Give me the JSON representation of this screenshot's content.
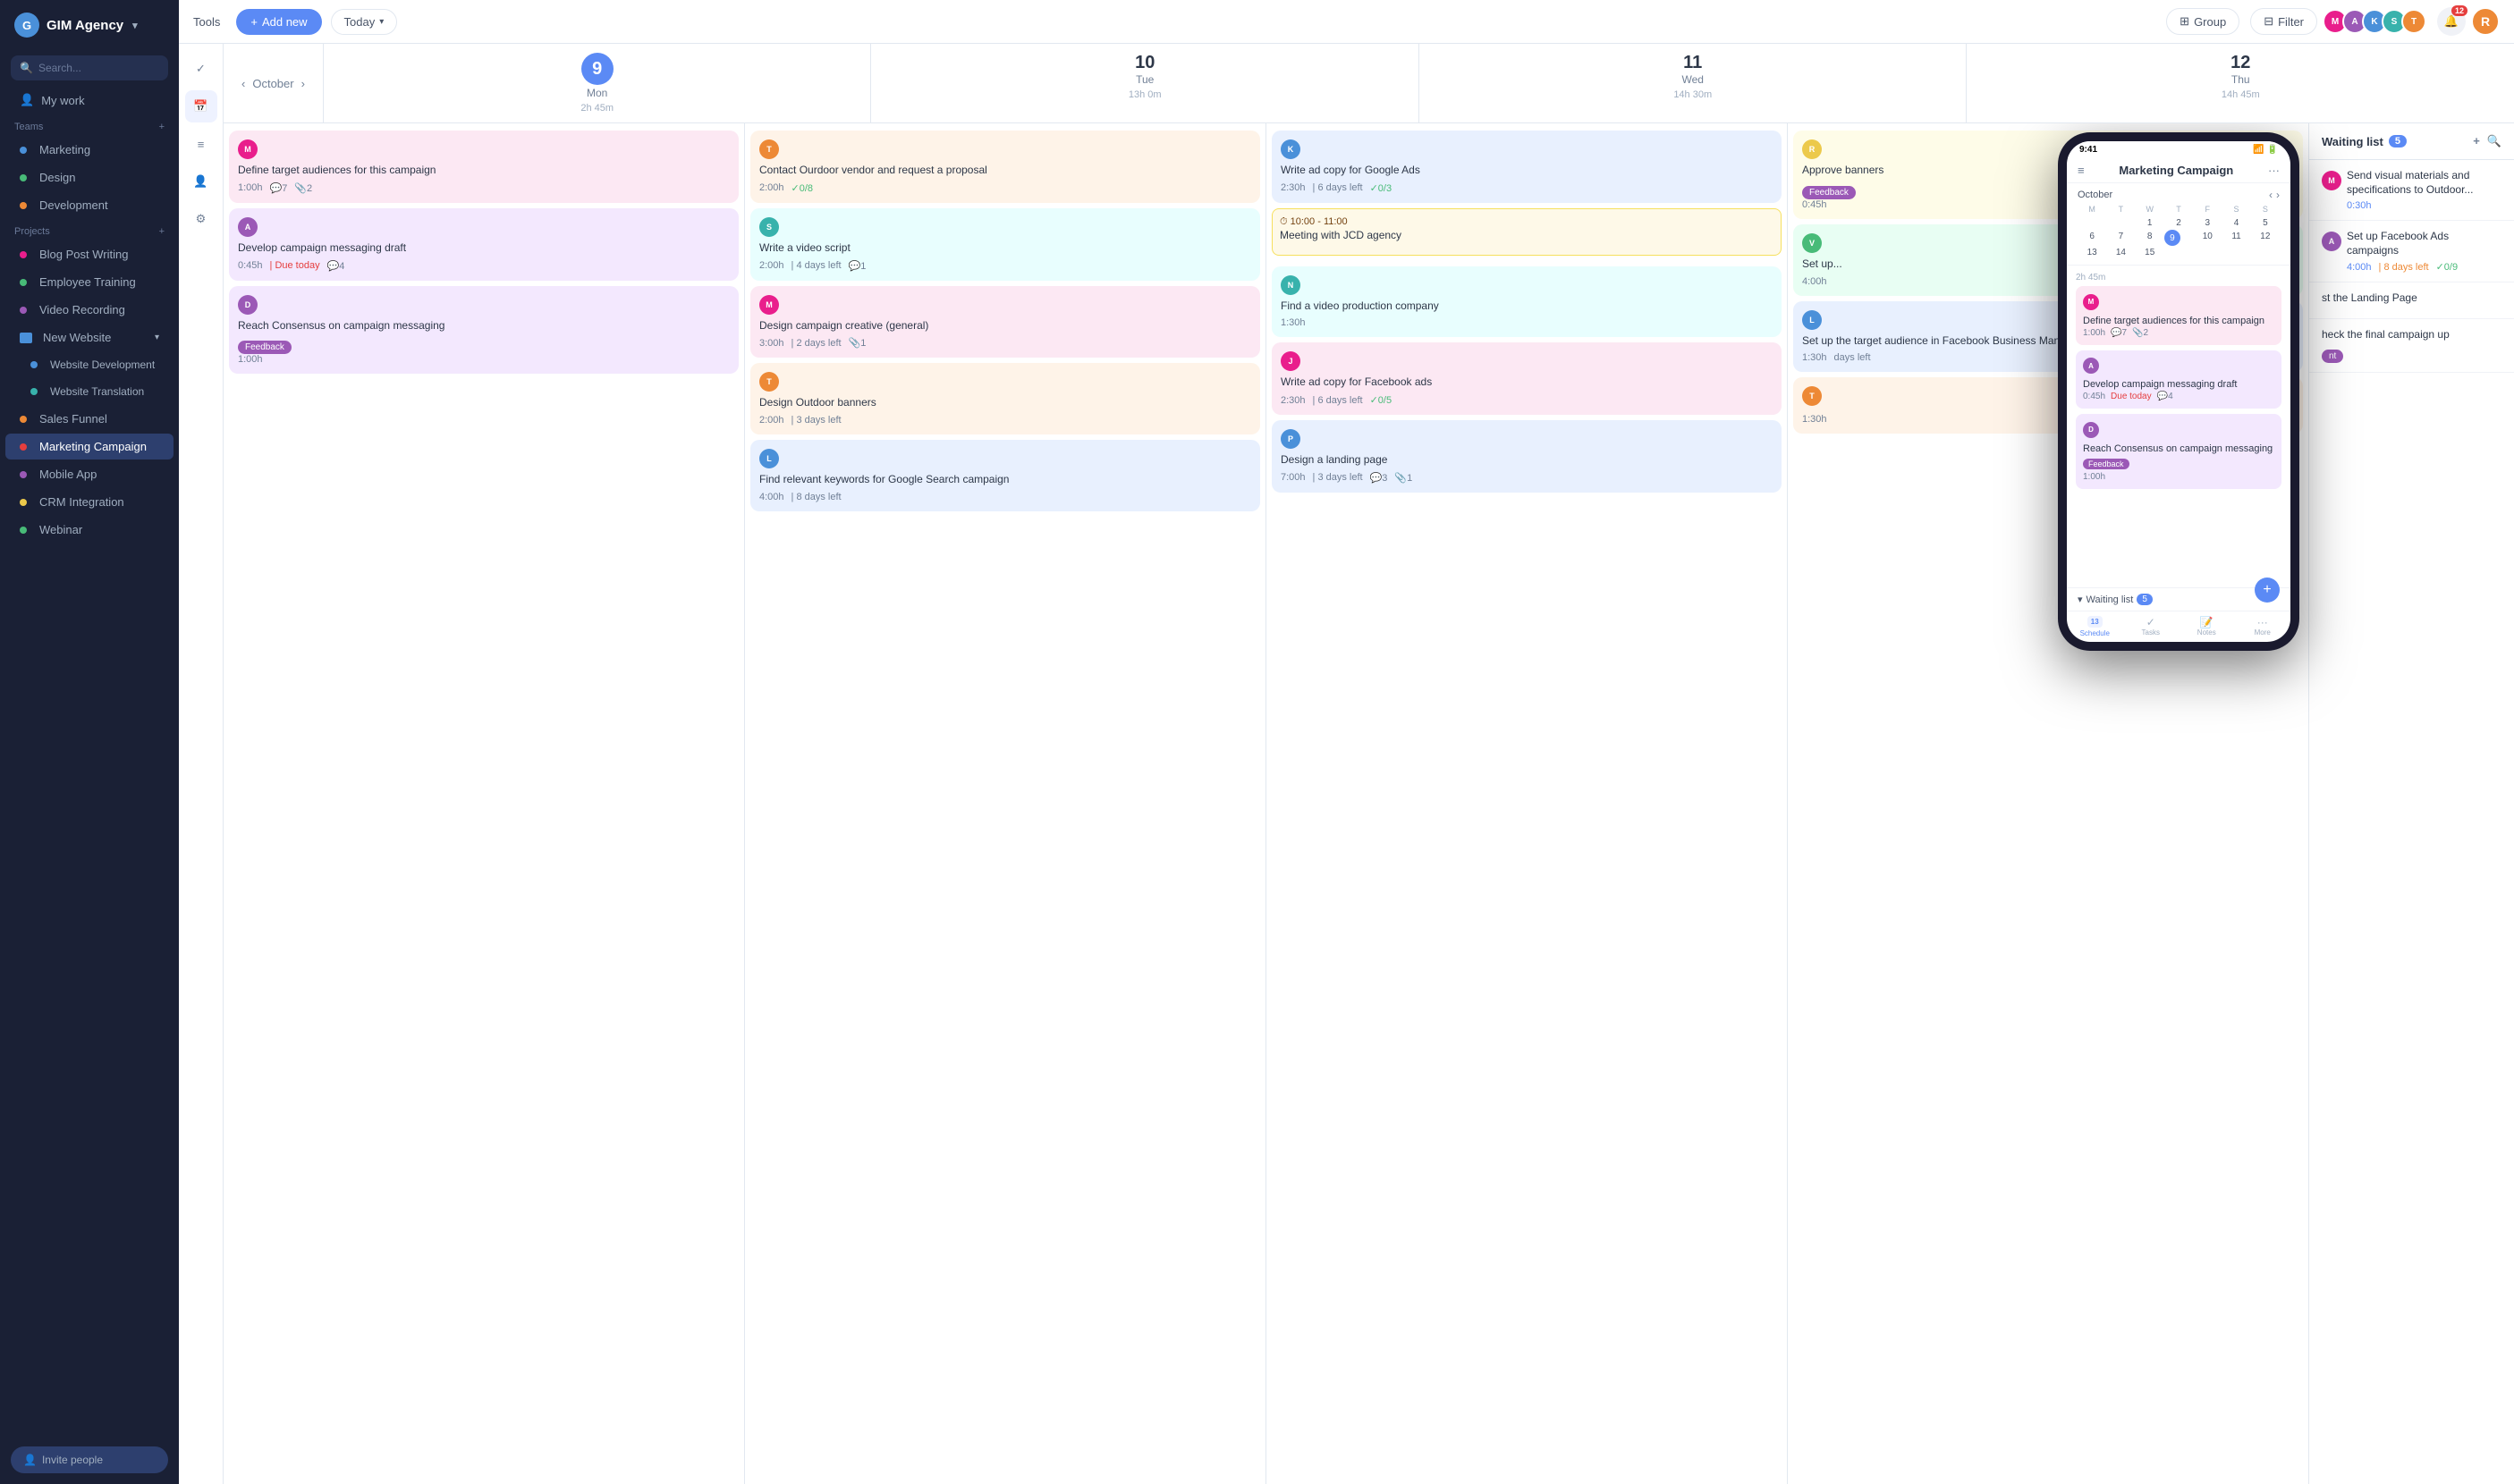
{
  "app": {
    "name": "GIM Agency",
    "logo_letter": "G"
  },
  "sidebar": {
    "search_placeholder": "Search...",
    "my_work": "My work",
    "teams_label": "Teams",
    "teams": [
      {
        "label": "Marketing",
        "color": "#4a90d9"
      },
      {
        "label": "Design",
        "color": "#48bb78"
      },
      {
        "label": "Development",
        "color": "#ed8936"
      }
    ],
    "projects_label": "Projects",
    "projects": [
      {
        "label": "Blog Post Writing",
        "color": "#e91e8c"
      },
      {
        "label": "Employee Training",
        "color": "#48bb78"
      },
      {
        "label": "Video Recording",
        "color": "#9b59b6"
      },
      {
        "label": "New Website",
        "color": "#4a90d9",
        "expanded": true
      },
      {
        "label": "Website Development",
        "color": "#4a90d9",
        "indented": true
      },
      {
        "label": "Website Translation",
        "color": "#38b2ac",
        "indented": true
      },
      {
        "label": "Sales Funnel",
        "color": "#ed8936"
      },
      {
        "label": "Marketing Campaign",
        "color": "#e53e3e",
        "active": true
      },
      {
        "label": "Mobile App",
        "color": "#9b59b6"
      },
      {
        "label": "CRM Integration",
        "color": "#ecc94b"
      },
      {
        "label": "Webinar",
        "color": "#48bb78"
      }
    ],
    "invite_btn": "Invite people"
  },
  "toolbar": {
    "tools_label": "Tools",
    "add_btn": "+ Add new",
    "today_btn": "Today",
    "group_btn": "Group",
    "filter_btn": "Filter"
  },
  "calendar": {
    "month": "October",
    "nav_prev": "‹",
    "nav_next": "›",
    "days": [
      {
        "num": "9",
        "name": "Mon",
        "time": "2h 45m",
        "today": true
      },
      {
        "num": "10",
        "name": "Tue",
        "time": "13h 0m"
      },
      {
        "num": "11",
        "name": "Wed",
        "time": "14h 30m"
      },
      {
        "num": "12",
        "name": "Thu",
        "time": "14h 45m"
      }
    ]
  },
  "tasks": {
    "mon": [
      {
        "title": "Define target audiences for this campaign",
        "time": "1:00h",
        "comments": 7,
        "attachments": 2,
        "color": "pink",
        "avatar_color": "#e91e8c",
        "avatar_letter": "M"
      },
      {
        "title": "Develop campaign messaging draft",
        "time": "0:45h",
        "due": "Due today",
        "comments": 4,
        "color": "purple",
        "avatar_color": "#9b59b6",
        "avatar_letter": "A"
      },
      {
        "title": "Reach Consensus on campaign messaging",
        "time": "1:00h",
        "badge": "Feedback",
        "color": "purple",
        "avatar_color": "#9b59b6",
        "avatar_letter": "D"
      }
    ],
    "tue": [
      {
        "title": "Contact Ourdoor vendor and request a proposal",
        "time": "2:00h",
        "checked": "0/8",
        "color": "orange",
        "avatar_color": "#ed8936",
        "avatar_letter": "T"
      },
      {
        "title": "Write a video script",
        "time": "2:00h",
        "days": "4 days left",
        "comments": 1,
        "color": "teal",
        "avatar_color": "#38b2ac",
        "avatar_letter": "S"
      },
      {
        "title": "Design campaign creative (general)",
        "time": "3:00h",
        "days": "2 days left",
        "attachments": 1,
        "color": "pink",
        "avatar_color": "#e91e8c",
        "avatar_letter": "M"
      },
      {
        "title": "Design Outdoor banners",
        "time": "2:00h",
        "days": "3 days left",
        "color": "orange",
        "avatar_color": "#ed8936",
        "avatar_letter": "T"
      },
      {
        "title": "Find relevant keywords for Google Search campaign",
        "time": "4:00h",
        "days": "8 days left",
        "color": "blue",
        "avatar_color": "#4a90d9",
        "avatar_letter": "L"
      }
    ],
    "wed": [
      {
        "title": "Write ad copy for Google Ads",
        "time": "2:30h",
        "days": "6 days left",
        "checked": "0/3",
        "color": "blue",
        "avatar_color": "#4a90d9",
        "avatar_letter": "K"
      },
      {
        "time_block": true,
        "time_label": "10:00 - 11:00",
        "title": "Meeting with JCD agency",
        "color": "yellow"
      },
      {
        "title": "Find a video production company",
        "time": "1:30h",
        "color": "teal",
        "avatar_color": "#38b2ac",
        "avatar_letter": "N"
      },
      {
        "title": "Write ad copy for Facebook ads",
        "time": "2:30h",
        "days": "6 days left",
        "checked": "0/5",
        "color": "pink",
        "avatar_color": "#e91e8c",
        "avatar_letter": "J"
      },
      {
        "title": "Design a landing page",
        "time": "7:00h",
        "days": "3 days left",
        "comments": 3,
        "attachments": 1,
        "color": "blue",
        "avatar_color": "#4a90d9",
        "avatar_letter": "P"
      }
    ],
    "thu": [
      {
        "title": "Approve banners",
        "time": "0:45h",
        "badge": "Feedback",
        "color": "yellow",
        "avatar_color": "#ecc94b",
        "avatar_letter": "R"
      },
      {
        "title": "Set up...",
        "time": "4:00h",
        "color": "green",
        "avatar_color": "#48bb78",
        "avatar_letter": "V",
        "partial": true
      },
      {
        "title": "Set up the target audience in Facebook Business Manager",
        "time": "1:30h",
        "days": "days left",
        "color": "blue",
        "avatar_color": "#4a90d9",
        "avatar_letter": "L",
        "partial": true
      },
      {
        "title": "",
        "time": "1:30h",
        "color": "orange",
        "avatar_color": "#ed8936",
        "avatar_letter": "T",
        "partial": true
      }
    ]
  },
  "waiting_list": {
    "title": "Waiting list",
    "count": 5,
    "items": [
      {
        "title": "Send visual materials and specifications to Outdoor...",
        "time": "0:30h",
        "avatar_color": "#e91e8c",
        "avatar_letter": "M"
      },
      {
        "title": "Set up Facebook Ads campaigns",
        "time": "4:00h",
        "days": "8 days left",
        "checked": "0/9",
        "avatar_color": "#9b59b6",
        "avatar_letter": "A"
      }
    ]
  },
  "mobile": {
    "time": "9:41",
    "title": "Marketing Campaign",
    "month": "October",
    "calendar_days_header": [
      "M",
      "T",
      "W",
      "T",
      "F",
      "S",
      "S"
    ],
    "calendar_days": [
      "",
      "",
      "1",
      "2",
      "3",
      "4",
      "5",
      "6",
      "7",
      "8",
      "9",
      "10",
      "11",
      "12",
      "13",
      "14",
      "15"
    ],
    "time_label": "2h 45m",
    "tasks": [
      {
        "title": "Define target audiences for this campaign",
        "time": "1:00h",
        "comments": 7,
        "attachments": 2,
        "color": "pink",
        "avatar_color": "#e91e8c"
      },
      {
        "title": "Develop campaign messaging draft",
        "time": "0:45h",
        "due": "Due today",
        "comments": 4,
        "color": "purple",
        "avatar_color": "#9b59b6"
      },
      {
        "title": "Reach Consensus on campaign messaging",
        "time": "1:00h",
        "badge": "Feedback",
        "color": "purple",
        "avatar_color": "#9b59b6"
      }
    ],
    "waiting_label": "Waiting list",
    "waiting_count": 5,
    "tabs": [
      {
        "label": "Schedule",
        "active": true,
        "badge": "13"
      },
      {
        "label": "Tasks",
        "active": false
      },
      {
        "label": "Notes",
        "active": false
      },
      {
        "label": "More",
        "active": false
      }
    ]
  },
  "waiting_list_right": {
    "title_right": "st the Landing Page",
    "title_right2": "heck the final campaign up"
  }
}
